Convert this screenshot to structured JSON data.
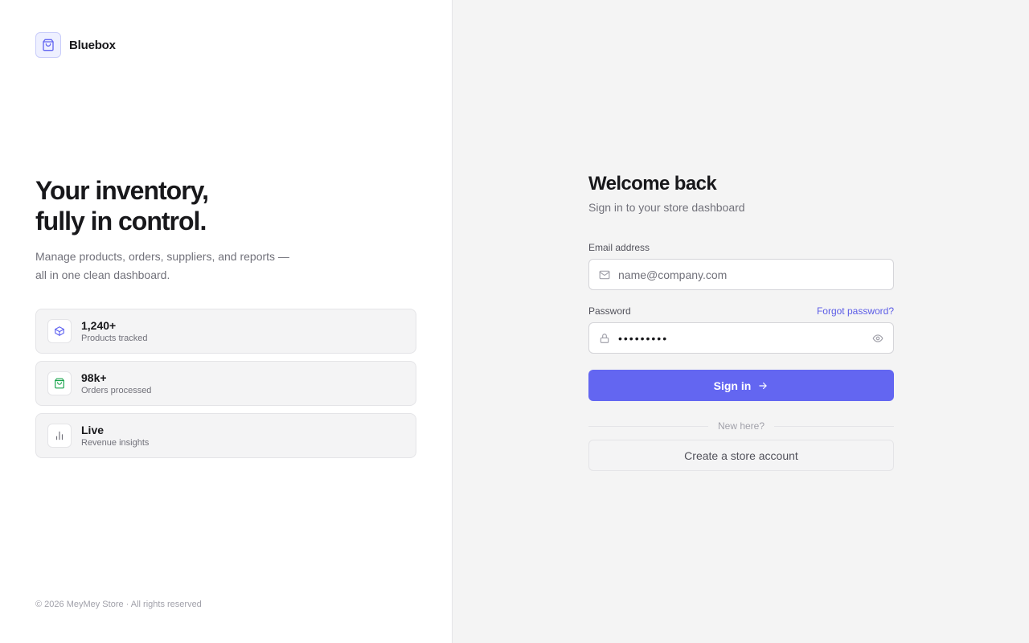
{
  "brand": {
    "name": "Bluebox",
    "logo_icon": "shopping-bag-icon",
    "accent": "#6366f1"
  },
  "hero": {
    "title_line1": "Your inventory,",
    "title_line2": "fully in control.",
    "subtitle": "Manage products, orders, suppliers, and reports — all in one clean dashboard."
  },
  "stats": [
    {
      "icon": "box-icon",
      "value": "1,240+",
      "label": "Products tracked",
      "color": "#6366f1"
    },
    {
      "icon": "shopping-bag-icon",
      "value": "98k+",
      "label": "Orders processed",
      "color": "#16a34a"
    },
    {
      "icon": "bar-chart-icon",
      "value": "Live",
      "label": "Revenue insights",
      "color": "#71717a"
    }
  ],
  "footer": {
    "text": "© 2026 MeyMey Store · All rights reserved"
  },
  "form": {
    "title": "Welcome back",
    "subtitle": "Sign in to your store dashboard",
    "email": {
      "label": "Email address",
      "placeholder": "name@company.com",
      "value": ""
    },
    "password": {
      "label": "Password",
      "value": "password1",
      "forgot_label": "Forgot password?"
    },
    "signin_label": "Sign in",
    "divider_text": "New here?",
    "create_label": "Create a store account"
  }
}
